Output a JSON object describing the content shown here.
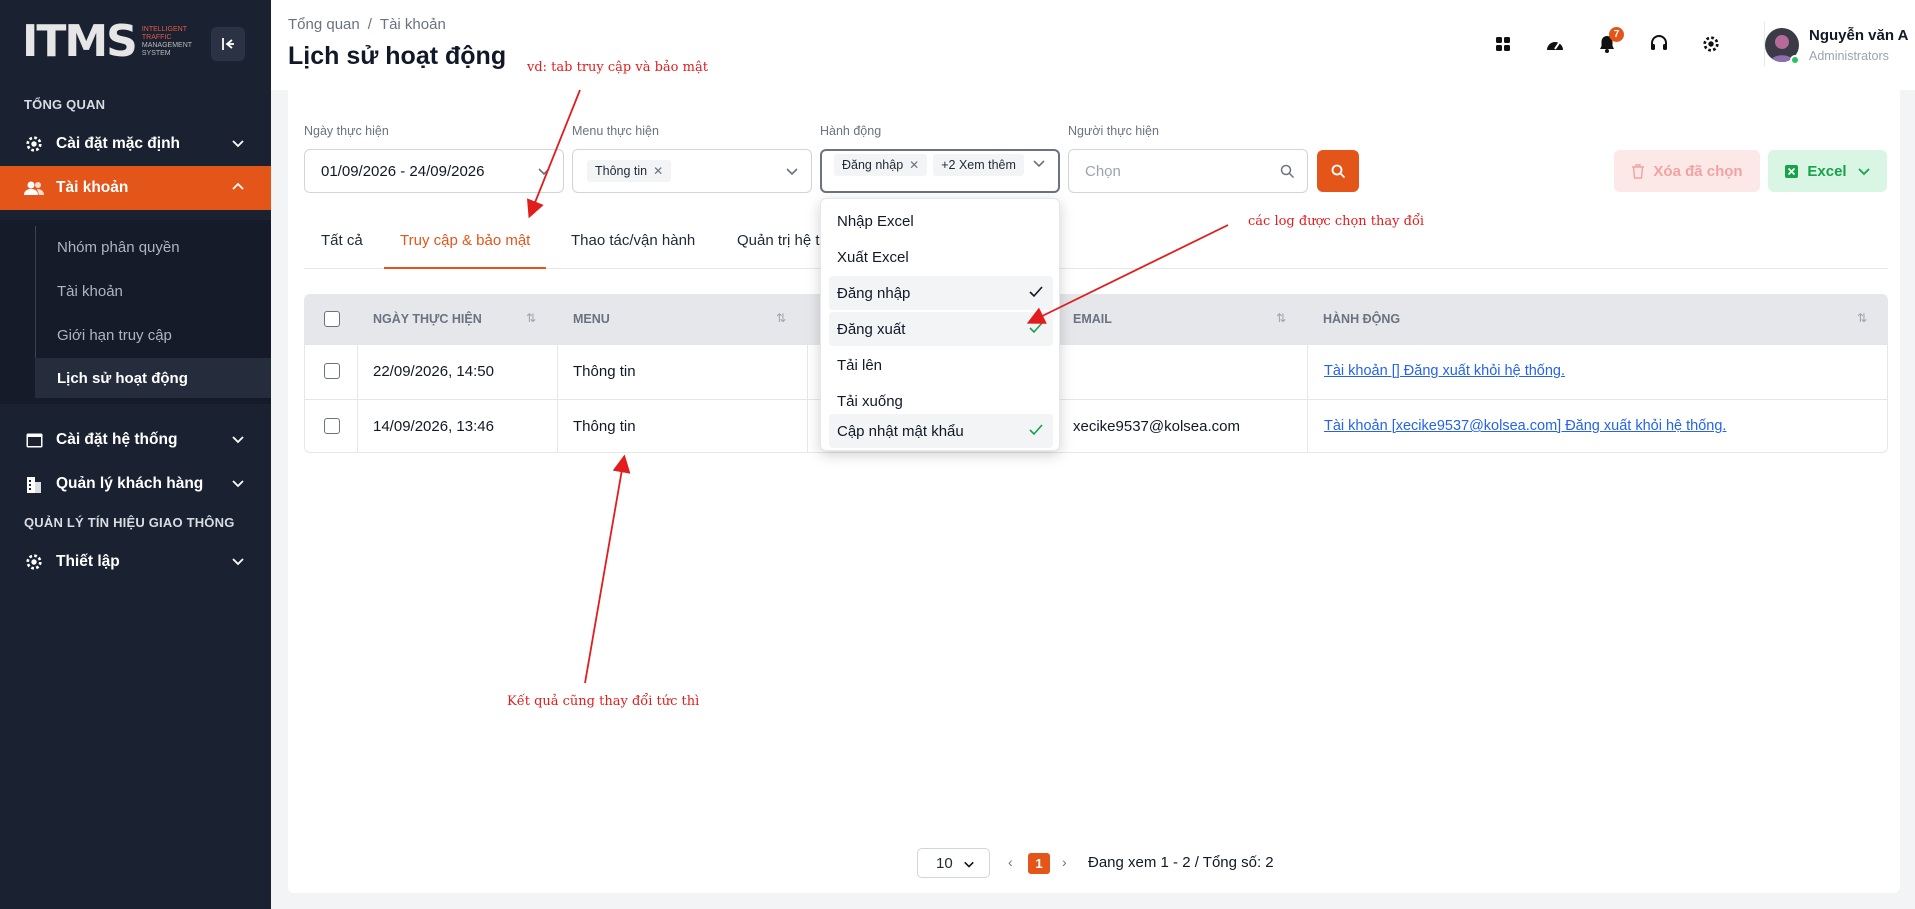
{
  "brand": {
    "logo_text": "ITMS",
    "sub_lines": [
      "INTELLIGENT",
      "TRAFFIC",
      "MANAGEMENT",
      "SYSTEM"
    ]
  },
  "sidebar": {
    "section_overview": "TỔNG QUAN",
    "section_signals": "QUẢN LÝ TÍN HIỆU GIAO THÔNG",
    "items": [
      {
        "label": "Cài đặt mặc định",
        "icon": "gear-icon"
      },
      {
        "label": "Tài khoản",
        "icon": "users-icon"
      },
      {
        "label": "Cài đặt hệ thống",
        "icon": "window-icon"
      },
      {
        "label": "Quản lý khách hàng",
        "icon": "building-icon"
      },
      {
        "label": "Thiết lập",
        "icon": "gear-icon"
      }
    ],
    "sub_items": [
      "Nhóm phân quyền",
      "Tài khoản",
      "Giới hạn truy cập",
      "Lịch sử hoạt động"
    ]
  },
  "header": {
    "breadcrumb": [
      "Tổng quan",
      "Tài khoản"
    ],
    "title": "Lịch sử hoạt động",
    "notification_count": "7",
    "user_name": "Nguyễn văn A",
    "user_role": "Administrators"
  },
  "filters": {
    "date_label": "Ngày thực hiện",
    "date_value": "01/09/2026 - 24/09/2026",
    "menu_label": "Menu thực hiện",
    "menu_tag": "Thông tin",
    "action_label": "Hành động",
    "action_tag": "Đăng nhập",
    "action_more": "+2 Xem thêm",
    "user_label": "Người thực hiện",
    "user_placeholder": "Chọn",
    "delete_label": "Xóa đã chọn",
    "excel_label": "Excel"
  },
  "tabs": [
    "Tất cả",
    "Truy cập & bảo mật",
    "Thao tác/vận hành",
    "Quản trị hệ t"
  ],
  "table": {
    "headers": [
      "NGÀY THỰC HIỆN",
      "MENU",
      "EMAIL",
      "HÀNH ĐỘNG"
    ],
    "rows": [
      {
        "date": "22/09/2026, 14:50",
        "menu": "Thông tin",
        "email": "",
        "action": "Tài khoản [] Đăng xuất khỏi hệ thống."
      },
      {
        "date": "14/09/2026, 13:46",
        "menu": "Thông tin",
        "email": "xecike9537@kolsea.com",
        "action": "Tài khoản [xecike9537@kolsea.com] Đăng xuất khỏi hệ thống."
      }
    ]
  },
  "dropdown": {
    "options": [
      {
        "label": "Nhập Excel",
        "selected": false
      },
      {
        "label": "Xuất Excel",
        "selected": false
      },
      {
        "label": "Đăng nhập",
        "selected": true
      },
      {
        "label": "Đăng xuất",
        "selected": true
      },
      {
        "label": "Tải lên",
        "selected": false
      },
      {
        "label": "Tải xuống",
        "selected": false
      },
      {
        "label": "Cập nhật mật khẩu",
        "selected": true
      }
    ]
  },
  "pagination": {
    "page_size": "10",
    "current_page": "1",
    "info": "Đang xem 1 - 2 / Tổng số: 2"
  },
  "annotations": {
    "tab_note": "vd: tab truy cập và bảo mật",
    "log_note": "các log được chọn thay đổi",
    "result_note": "Kết quả cũng thay đổi tức thì"
  },
  "colors": {
    "accent": "#e4551a",
    "sidebar_bg": "#1a2131",
    "annotation": "#e11d1d",
    "excel_green": "#16a34a"
  }
}
